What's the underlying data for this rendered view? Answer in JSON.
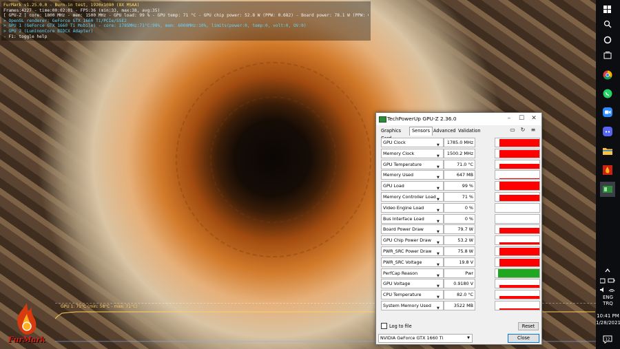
{
  "furmark": {
    "osd_lines": [
      {
        "text": "FurMark v1.25.0.0 - Burn-in test, 1920x1080 (8X MSAA)",
        "color": "y"
      },
      {
        "text": "Frames:4227 - time:00:02:01 - FPS:36 (min:33, max:38, avg:35)",
        "color": "w"
      },
      {
        "text": "[ GPU-Z ] core: 1800 MHz - mem: 1500 MHz - GPU load: 99 % - GPU temp: 71 °C - GPU chip power: 52.8 W (PPW: 0.682) - Board power: 78.1 W (PPW: 0.455) - GPU voltage: 0.918 V",
        "color": "w"
      },
      {
        "text": "> OpenGL renderer: GeForce GTX 1660 Ti/PCIe/SSE2",
        "color": "c"
      },
      {
        "text": "> GPU 1 (GeForce GTX 1660 Ti Mobile) - core: 1785MHz:71°C:99%, mem: 6000MHz:10%, limits(power:0, temp:0, volt:0, OV:0)",
        "color": "c"
      },
      {
        "text": "> GPU 2 (LuminonCore BIDCX Adapter)",
        "color": "c"
      },
      {
        "text": "- F1: toggle help",
        "color": "w"
      }
    ],
    "graph_label": "GPU 1: 71°C (min: 58°C - max: 71°C)",
    "logo_text": "FurMark"
  },
  "taskbar": {
    "lang": "ENG",
    "layout": "TRQ",
    "time": "10:41 PM",
    "date": "1/28/2021",
    "notification_count": "12"
  },
  "gpuz": {
    "title": "TechPowerUp GPU-Z 2.36.0",
    "tabs": [
      "Graphics Card",
      "Sensors",
      "Advanced",
      "Validation"
    ],
    "active_tab": "Sensors",
    "sensors": [
      {
        "name": "GPU Clock",
        "value": "1785.0 MHz",
        "level": 0.92
      },
      {
        "name": "Memory Clock",
        "value": "1500.2 MHz",
        "level": 0.9
      },
      {
        "name": "GPU Temperature",
        "value": "71.0 °C",
        "level": 0.55
      },
      {
        "name": "Memory Used",
        "value": "647 MB",
        "level": 0.08
      },
      {
        "name": "GPU Load",
        "value": "99 %",
        "level": 0.99
      },
      {
        "name": "Memory Controller Load",
        "value": "71 %",
        "level": 0.72
      },
      {
        "name": "Video Engine Load",
        "value": "0 %",
        "level": 0
      },
      {
        "name": "Bus Interface Load",
        "value": "0 %",
        "level": 0
      },
      {
        "name": "Board Power Draw",
        "value": "79.7 W",
        "level": 0.7
      },
      {
        "name": "GPU Chip Power Draw",
        "value": "53.2 W",
        "level": 0.25
      },
      {
        "name": "PWR_SRC Power Draw",
        "value": "75.8 W",
        "level": 0.92
      },
      {
        "name": "PWR_SRC Voltage",
        "value": "19.8 V",
        "level": 0.95
      },
      {
        "name": "PerfCap Reason",
        "value": "Pwr",
        "level": 1
      },
      {
        "name": "GPU Voltage",
        "value": "0.9180 V",
        "level": 0.3
      },
      {
        "name": "CPU Temperature",
        "value": "82.0 °C",
        "level": 0.35
      },
      {
        "name": "System Memory Used",
        "value": "3522 MB",
        "level": 0.2
      }
    ],
    "colors": {
      "bar": "#ff0000",
      "perfcap": "#1fa81f"
    },
    "log_label": "Log to file",
    "reset_label": "Reset",
    "gpu_selected": "NVIDIA GeForce GTX 1660 Ti",
    "close_label": "Close"
  }
}
